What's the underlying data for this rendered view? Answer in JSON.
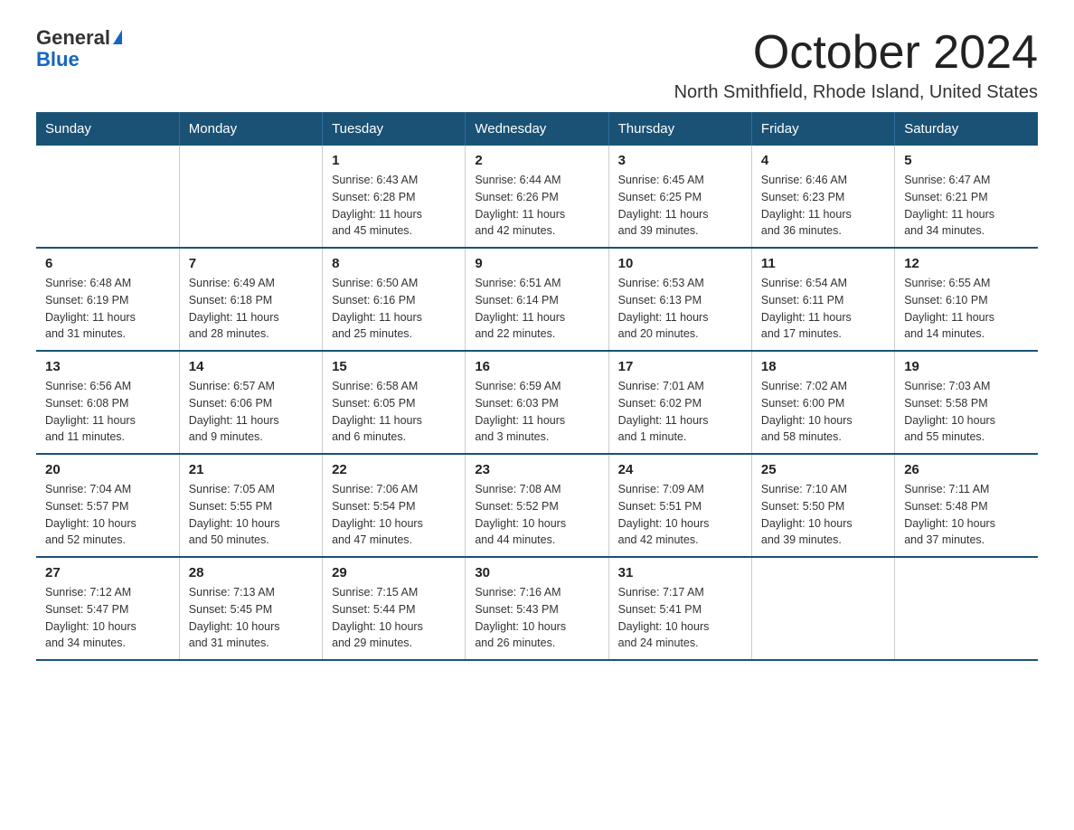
{
  "logo": {
    "text_general": "General",
    "text_blue": "Blue",
    "icon_label": "logo-triangle"
  },
  "header": {
    "title": "October 2024",
    "subtitle": "North Smithfield, Rhode Island, United States"
  },
  "days_of_week": [
    "Sunday",
    "Monday",
    "Tuesday",
    "Wednesday",
    "Thursday",
    "Friday",
    "Saturday"
  ],
  "weeks": [
    [
      {
        "day": "",
        "info": ""
      },
      {
        "day": "",
        "info": ""
      },
      {
        "day": "1",
        "info": "Sunrise: 6:43 AM\nSunset: 6:28 PM\nDaylight: 11 hours\nand 45 minutes."
      },
      {
        "day": "2",
        "info": "Sunrise: 6:44 AM\nSunset: 6:26 PM\nDaylight: 11 hours\nand 42 minutes."
      },
      {
        "day": "3",
        "info": "Sunrise: 6:45 AM\nSunset: 6:25 PM\nDaylight: 11 hours\nand 39 minutes."
      },
      {
        "day": "4",
        "info": "Sunrise: 6:46 AM\nSunset: 6:23 PM\nDaylight: 11 hours\nand 36 minutes."
      },
      {
        "day": "5",
        "info": "Sunrise: 6:47 AM\nSunset: 6:21 PM\nDaylight: 11 hours\nand 34 minutes."
      }
    ],
    [
      {
        "day": "6",
        "info": "Sunrise: 6:48 AM\nSunset: 6:19 PM\nDaylight: 11 hours\nand 31 minutes."
      },
      {
        "day": "7",
        "info": "Sunrise: 6:49 AM\nSunset: 6:18 PM\nDaylight: 11 hours\nand 28 minutes."
      },
      {
        "day": "8",
        "info": "Sunrise: 6:50 AM\nSunset: 6:16 PM\nDaylight: 11 hours\nand 25 minutes."
      },
      {
        "day": "9",
        "info": "Sunrise: 6:51 AM\nSunset: 6:14 PM\nDaylight: 11 hours\nand 22 minutes."
      },
      {
        "day": "10",
        "info": "Sunrise: 6:53 AM\nSunset: 6:13 PM\nDaylight: 11 hours\nand 20 minutes."
      },
      {
        "day": "11",
        "info": "Sunrise: 6:54 AM\nSunset: 6:11 PM\nDaylight: 11 hours\nand 17 minutes."
      },
      {
        "day": "12",
        "info": "Sunrise: 6:55 AM\nSunset: 6:10 PM\nDaylight: 11 hours\nand 14 minutes."
      }
    ],
    [
      {
        "day": "13",
        "info": "Sunrise: 6:56 AM\nSunset: 6:08 PM\nDaylight: 11 hours\nand 11 minutes."
      },
      {
        "day": "14",
        "info": "Sunrise: 6:57 AM\nSunset: 6:06 PM\nDaylight: 11 hours\nand 9 minutes."
      },
      {
        "day": "15",
        "info": "Sunrise: 6:58 AM\nSunset: 6:05 PM\nDaylight: 11 hours\nand 6 minutes."
      },
      {
        "day": "16",
        "info": "Sunrise: 6:59 AM\nSunset: 6:03 PM\nDaylight: 11 hours\nand 3 minutes."
      },
      {
        "day": "17",
        "info": "Sunrise: 7:01 AM\nSunset: 6:02 PM\nDaylight: 11 hours\nand 1 minute."
      },
      {
        "day": "18",
        "info": "Sunrise: 7:02 AM\nSunset: 6:00 PM\nDaylight: 10 hours\nand 58 minutes."
      },
      {
        "day": "19",
        "info": "Sunrise: 7:03 AM\nSunset: 5:58 PM\nDaylight: 10 hours\nand 55 minutes."
      }
    ],
    [
      {
        "day": "20",
        "info": "Sunrise: 7:04 AM\nSunset: 5:57 PM\nDaylight: 10 hours\nand 52 minutes."
      },
      {
        "day": "21",
        "info": "Sunrise: 7:05 AM\nSunset: 5:55 PM\nDaylight: 10 hours\nand 50 minutes."
      },
      {
        "day": "22",
        "info": "Sunrise: 7:06 AM\nSunset: 5:54 PM\nDaylight: 10 hours\nand 47 minutes."
      },
      {
        "day": "23",
        "info": "Sunrise: 7:08 AM\nSunset: 5:52 PM\nDaylight: 10 hours\nand 44 minutes."
      },
      {
        "day": "24",
        "info": "Sunrise: 7:09 AM\nSunset: 5:51 PM\nDaylight: 10 hours\nand 42 minutes."
      },
      {
        "day": "25",
        "info": "Sunrise: 7:10 AM\nSunset: 5:50 PM\nDaylight: 10 hours\nand 39 minutes."
      },
      {
        "day": "26",
        "info": "Sunrise: 7:11 AM\nSunset: 5:48 PM\nDaylight: 10 hours\nand 37 minutes."
      }
    ],
    [
      {
        "day": "27",
        "info": "Sunrise: 7:12 AM\nSunset: 5:47 PM\nDaylight: 10 hours\nand 34 minutes."
      },
      {
        "day": "28",
        "info": "Sunrise: 7:13 AM\nSunset: 5:45 PM\nDaylight: 10 hours\nand 31 minutes."
      },
      {
        "day": "29",
        "info": "Sunrise: 7:15 AM\nSunset: 5:44 PM\nDaylight: 10 hours\nand 29 minutes."
      },
      {
        "day": "30",
        "info": "Sunrise: 7:16 AM\nSunset: 5:43 PM\nDaylight: 10 hours\nand 26 minutes."
      },
      {
        "day": "31",
        "info": "Sunrise: 7:17 AM\nSunset: 5:41 PM\nDaylight: 10 hours\nand 24 minutes."
      },
      {
        "day": "",
        "info": ""
      },
      {
        "day": "",
        "info": ""
      }
    ]
  ]
}
